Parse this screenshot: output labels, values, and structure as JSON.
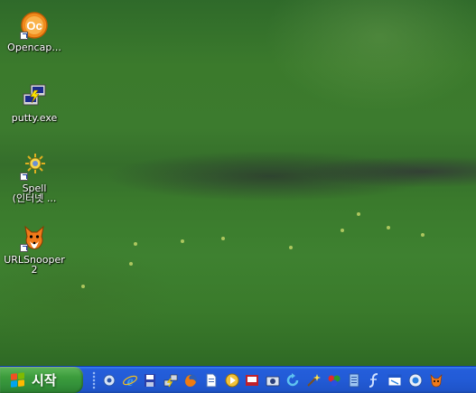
{
  "desktop": {
    "icons": [
      {
        "label": "Opencap...",
        "icon": "opencapture-icon",
        "shortcut": true
      },
      {
        "label": "putty.exe",
        "icon": "putty-icon",
        "shortcut": false
      },
      {
        "label": "Spell\n(인터넷 ...",
        "icon": "spell-icon",
        "shortcut": true
      },
      {
        "label": "URLSnooper\n2",
        "icon": "urlsnooper-icon",
        "shortcut": true
      }
    ]
  },
  "taskbar": {
    "start_label": "시작",
    "quicklaunch": [
      "settings-icon",
      "internet-explorer-icon",
      "save-disk-icon",
      "network-icon",
      "firefox-icon",
      "document-icon",
      "media-player-icon",
      "presentation-icon",
      "camera-icon",
      "refresh-icon",
      "magic-wand-icon",
      "color-balls-icon",
      "notepad-icon",
      "script-icon",
      "window-icon",
      "messenger-icon",
      "fox-icon"
    ]
  },
  "colors": {
    "taskbar": "#245edb",
    "start_button": "#3c9c3c",
    "wallpaper_grass": "#3c7b2e"
  }
}
